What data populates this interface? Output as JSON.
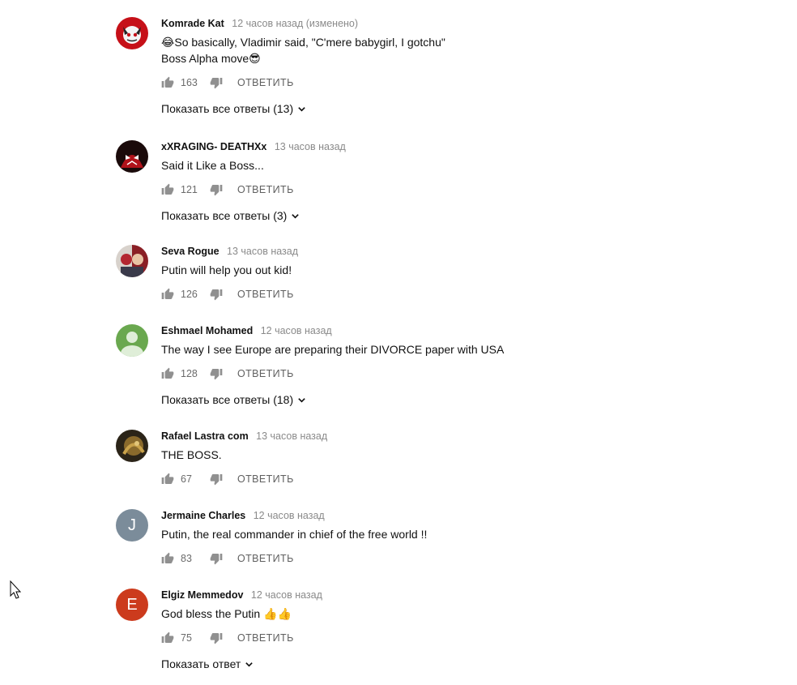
{
  "colors": {
    "link_text": "#111111",
    "meta_gray": "#8a8a8a",
    "icon_gray": "#606060",
    "avatar_green": "#6aa84f",
    "avatar_slate": "#7b8c9a",
    "avatar_red": "#cc3b1d"
  },
  "reply_label": "ОТВЕТИТЬ",
  "comments": [
    {
      "author": "Komrade Kat",
      "time": "12 часов назад (изменено)",
      "text": "😂So basically, Vladimir said, \"C'mere babygirl, I gotchu\"\nBoss Alpha move😎",
      "likes": "163",
      "replies_label": "Показать все ответы (13)",
      "avatar": "image"
    },
    {
      "author": "xXRAGING- DEATHXx",
      "time": "13 часов назад",
      "text": "Said it Like a Boss...",
      "likes": "121",
      "replies_label": "Показать все ответы (3)",
      "avatar": "image"
    },
    {
      "author": "Seva Rogue",
      "time": "13 часов назад",
      "text": "Putin will help you out kid!",
      "likes": "126",
      "replies_label": "",
      "avatar": "image"
    },
    {
      "author": "Eshmael Mohamed",
      "time": "12 часов назад",
      "text": "The way I see Europe are  preparing their DIVORCE paper with USA",
      "likes": "128",
      "replies_label": "Показать все ответы (18)",
      "avatar": "default-person"
    },
    {
      "author": "Rafael Lastra com",
      "time": "13 часов назад",
      "text": "THE BOSS.",
      "likes": "67",
      "replies_label": "",
      "avatar": "image"
    },
    {
      "author": "Jermaine Charles",
      "time": "12 часов назад",
      "text": "Putin, the real commander in chief of the free world !!",
      "likes": "83",
      "replies_label": "",
      "avatar": "letter",
      "avatar_letter": "J"
    },
    {
      "author": "Elgiz Memmedov",
      "time": "12 часов назад",
      "text": "God bless the Putin 👍👍",
      "likes": "75",
      "replies_label": "Показать ответ",
      "avatar": "letter",
      "avatar_letter": "E"
    }
  ]
}
